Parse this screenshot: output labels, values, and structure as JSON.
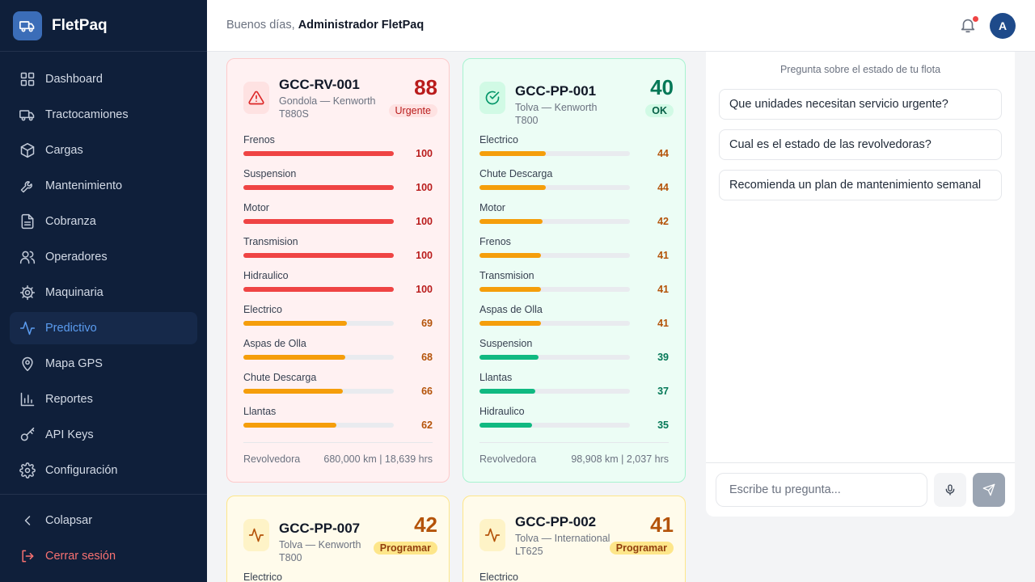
{
  "brand": {
    "name": "FletPaq"
  },
  "nav": [
    {
      "key": "dashboard",
      "label": "Dashboard",
      "icon": "layout-grid-icon",
      "active": false
    },
    {
      "key": "tractocamiones",
      "label": "Tractocamiones",
      "icon": "truck-icon",
      "active": false
    },
    {
      "key": "cargas",
      "label": "Cargas",
      "icon": "package-icon",
      "active": false
    },
    {
      "key": "mantenimiento",
      "label": "Mantenimiento",
      "icon": "wrench-icon",
      "active": false
    },
    {
      "key": "cobranza",
      "label": "Cobranza",
      "icon": "file-text-icon",
      "active": false
    },
    {
      "key": "operadores",
      "label": "Operadores",
      "icon": "users-icon",
      "active": false
    },
    {
      "key": "maquinaria",
      "label": "Maquinaria",
      "icon": "cog-icon",
      "active": false
    },
    {
      "key": "predictivo",
      "label": "Predictivo",
      "icon": "activity-icon",
      "active": true
    },
    {
      "key": "mapa-gps",
      "label": "Mapa GPS",
      "icon": "map-pin-icon",
      "active": false
    },
    {
      "key": "reportes",
      "label": "Reportes",
      "icon": "bar-chart-icon",
      "active": false
    },
    {
      "key": "api-keys",
      "label": "API Keys",
      "icon": "key-icon",
      "active": false
    },
    {
      "key": "configuracion",
      "label": "Configuración",
      "icon": "settings-icon",
      "active": false
    }
  ],
  "sidebar_bottom": {
    "collapse_label": "Colapsar",
    "logout_label": "Cerrar sesión"
  },
  "header": {
    "greeting": "Buenos días,",
    "user_name": "Administrador FletPaq",
    "avatar_initial": "A"
  },
  "colors": {
    "red": "#ef4444",
    "amber": "#f59e0b",
    "green": "#10b981",
    "red_text": "#b91c1c",
    "amber_text": "#b45309",
    "green_text": "#047857"
  },
  "cards": [
    {
      "id": "GCC-RV-001",
      "subtitle": "Gondola — Kenworth T880S",
      "score": "88",
      "status": "Urgente",
      "variant": "red",
      "icon": "alert-triangle-icon",
      "metrics": [
        {
          "name": "Frenos",
          "value": 100,
          "level": "red"
        },
        {
          "name": "Suspension",
          "value": 100,
          "level": "red"
        },
        {
          "name": "Motor",
          "value": 100,
          "level": "red"
        },
        {
          "name": "Transmision",
          "value": 100,
          "level": "red"
        },
        {
          "name": "Hidraulico",
          "value": 100,
          "level": "red"
        },
        {
          "name": "Electrico",
          "value": 69,
          "level": "amber"
        },
        {
          "name": "Aspas de Olla",
          "value": 68,
          "level": "amber"
        },
        {
          "name": "Chute Descarga",
          "value": 66,
          "level": "amber"
        },
        {
          "name": "Llantas",
          "value": 62,
          "level": "amber"
        }
      ],
      "type": "Revolvedora",
      "usage": "680,000 km | 18,639 hrs"
    },
    {
      "id": "GCC-PP-001",
      "subtitle": "Tolva — Kenworth T800",
      "score": "40",
      "status": "OK",
      "variant": "green",
      "icon": "check-circle-icon",
      "metrics": [
        {
          "name": "Electrico",
          "value": 44,
          "level": "amber"
        },
        {
          "name": "Chute Descarga",
          "value": 44,
          "level": "amber"
        },
        {
          "name": "Motor",
          "value": 42,
          "level": "amber"
        },
        {
          "name": "Frenos",
          "value": 41,
          "level": "amber"
        },
        {
          "name": "Transmision",
          "value": 41,
          "level": "amber"
        },
        {
          "name": "Aspas de Olla",
          "value": 41,
          "level": "amber"
        },
        {
          "name": "Suspension",
          "value": 39,
          "level": "green"
        },
        {
          "name": "Llantas",
          "value": 37,
          "level": "green"
        },
        {
          "name": "Hidraulico",
          "value": 35,
          "level": "green"
        }
      ],
      "type": "Revolvedora",
      "usage": "98,908 km | 2,037 hrs"
    },
    {
      "id": "GCC-PP-007",
      "subtitle": "Tolva — Kenworth T800",
      "score": "42",
      "status": "Programar",
      "variant": "amber",
      "icon": "activity-icon",
      "metrics": [
        {
          "name": "Electrico"
        }
      ]
    },
    {
      "id": "GCC-PP-002",
      "subtitle": "Tolva — International LT625",
      "score": "41",
      "status": "Programar",
      "variant": "amber",
      "icon": "activity-icon",
      "metrics": [
        {
          "name": "Electrico"
        }
      ]
    }
  ],
  "chat": {
    "hint": "Pregunta sobre el estado de tu flota",
    "suggestions": [
      "Que unidades necesitan servicio urgente?",
      "Cual es el estado de las revolvedoras?",
      "Recomienda un plan de mantenimiento semanal"
    ],
    "input_placeholder": "Escribe tu pregunta...",
    "input_value": ""
  }
}
